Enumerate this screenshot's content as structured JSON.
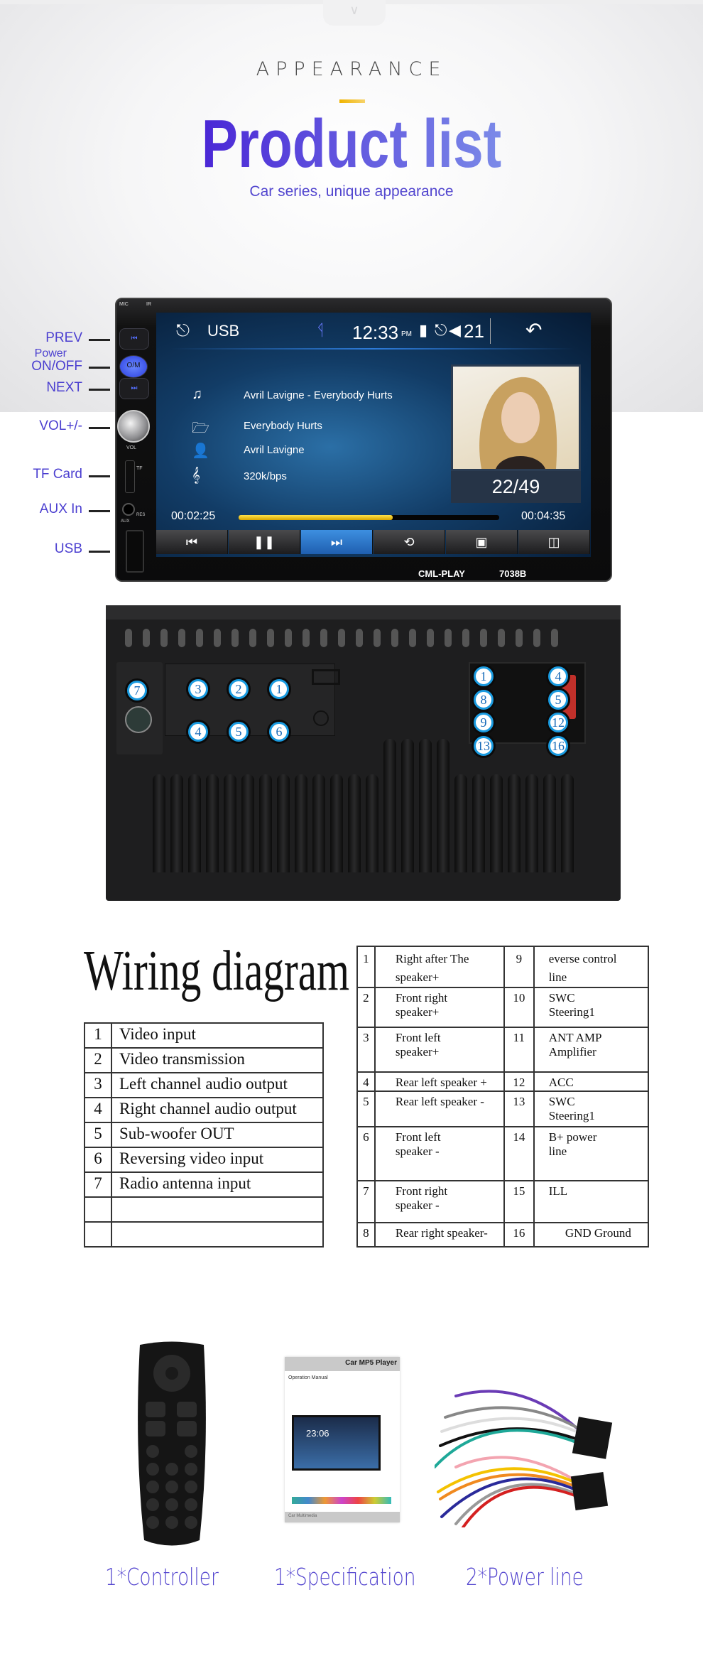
{
  "header": {
    "chevron_icon": "chevron-down-icon",
    "eyebrow": "APPEARANCE",
    "title": "Product list",
    "subtitle": "Car series, unique appearance",
    "accent_color": "#f0b400",
    "title_gradient": [
      "#4a27d6",
      "#7b8ae8"
    ]
  },
  "front_panel": {
    "side_labels": [
      "PREV",
      "Power",
      "ON/OFF",
      "NEXT",
      "VOL+/-",
      "TF Card",
      "AUX In",
      "USB"
    ],
    "bezel_marks": {
      "mic": "MIC",
      "ir": "IR",
      "power_button": "O/M",
      "vol": "VOL",
      "tf": "TF",
      "res": "RES",
      "aux": "AUX"
    },
    "brand": "CML-PLAY",
    "model": "7038B",
    "screen": {
      "source": "USB",
      "time": "12:33",
      "ampm": "PM",
      "volume": "21",
      "track_title": "Avril Lavigne - Everybody Hurts",
      "album": "Everybody Hurts",
      "artist": "Avril Lavigne",
      "bitrate": "320k/bps",
      "track_counter": "22/49",
      "elapsed": "00:02:25",
      "duration": "00:04:35",
      "progress_fraction": 0.59,
      "controls": [
        {
          "icon": "previous-icon",
          "glyph": "⏮"
        },
        {
          "icon": "pause-icon",
          "glyph": "❚❚"
        },
        {
          "icon": "next-icon",
          "glyph": "⏭",
          "active": true
        },
        {
          "icon": "repeat-icon",
          "glyph": "⟲"
        },
        {
          "icon": "image-icon",
          "glyph": "▣"
        },
        {
          "icon": "video-icon",
          "glyph": "◫"
        }
      ]
    }
  },
  "back_panel": {
    "rca_ports": [
      "3",
      "2",
      "1",
      "4",
      "5",
      "6"
    ],
    "antenna_port": "7",
    "connector_pins": [
      "1",
      "4",
      "8",
      "5",
      "9",
      "12",
      "13",
      "16"
    ],
    "highlight_color": "#1a9be0"
  },
  "wiring": {
    "title": "Wiring diagram",
    "rca_table": [
      [
        "1",
        "Video input"
      ],
      [
        "2",
        "Video transmission"
      ],
      [
        "3",
        "Left channel audio output"
      ],
      [
        "4",
        "Right channel audio output"
      ],
      [
        "5",
        "Sub-woofer OUT"
      ],
      [
        "6",
        "Reversing video input"
      ],
      [
        "7",
        "Radio antenna input"
      ],
      [
        "",
        ""
      ],
      [
        "",
        ""
      ]
    ],
    "pin_table": [
      [
        "1",
        "Right after The\nspeaker+",
        "9",
        "everse control\nline"
      ],
      [
        "2",
        "Front  right\nspeaker+",
        "10",
        "SWC\nSteering1"
      ],
      [
        "3",
        "Front  left\nspeaker+",
        "11",
        "ANT AMP\nAmplifier"
      ],
      [
        "4",
        "Rear left speaker +",
        "12",
        "ACC"
      ],
      [
        "5",
        "Rear left speaker -",
        "13",
        "SWC\nSteering1"
      ],
      [
        "6",
        "Front  left\nspeaker -",
        "14",
        "B+ power\nline"
      ],
      [
        "7",
        "Front  right\nspeaker -",
        "15",
        "ILL"
      ],
      [
        "8",
        "Rear right speaker-",
        "16",
        "GND Ground"
      ]
    ]
  },
  "accessories": [
    {
      "label": "1*Controller"
    },
    {
      "label": "1*Specification",
      "manual_title": "Car MP5 Player",
      "manual_subtitle": "Operation Manual",
      "manual_time": "23:06",
      "manual_footer": "Car Multimedia"
    },
    {
      "label": "2*Power line"
    }
  ]
}
